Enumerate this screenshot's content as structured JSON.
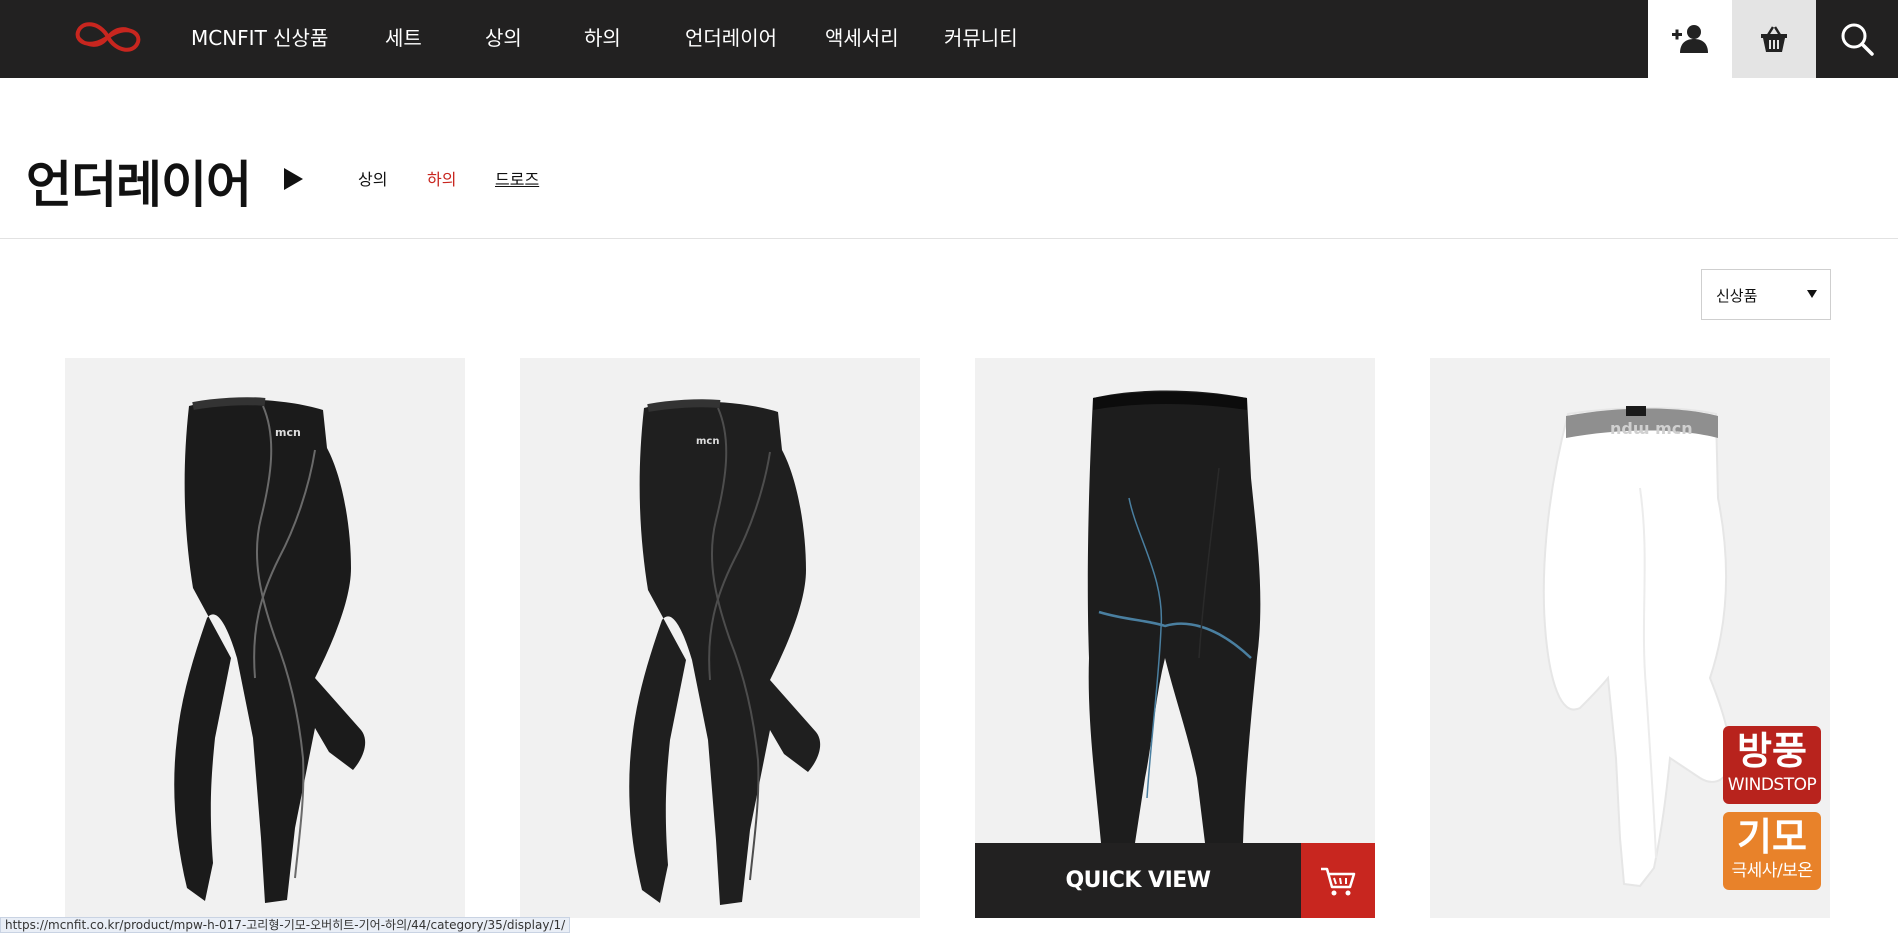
{
  "header": {
    "brand": "MCNFIT 신상품",
    "nav": [
      "세트",
      "상의",
      "하의",
      "언더레이어",
      "액세서리",
      "커뮤니티"
    ],
    "icons": [
      "user-plus-icon",
      "basket-icon",
      "search-icon"
    ],
    "colors": {
      "bar": "#222121",
      "accent": "#c8261f"
    }
  },
  "category": {
    "title": "언더레이어",
    "subs": [
      "상의",
      "하의",
      "드로즈"
    ],
    "active": "하의"
  },
  "sort": {
    "selected": "신상품"
  },
  "products": [
    {
      "image": "black-leggings-gray-seams"
    },
    {
      "image": "black-leggings-dark-seams"
    },
    {
      "image": "black-leggings-blue-seams",
      "quick_view": "QUICK VIEW"
    },
    {
      "image": "white-leggings",
      "badges": [
        {
          "title": "방풍",
          "sub": "WINDSTOP",
          "color": "#b8231d"
        },
        {
          "title": "기모",
          "sub": "극세사/보온",
          "color": "#e8822a"
        }
      ]
    }
  ],
  "status_url": "https://mcnfit.co.kr/product/mpw-h-017-고리형-기모-오버히트-기어-하의/44/category/35/display/1/"
}
